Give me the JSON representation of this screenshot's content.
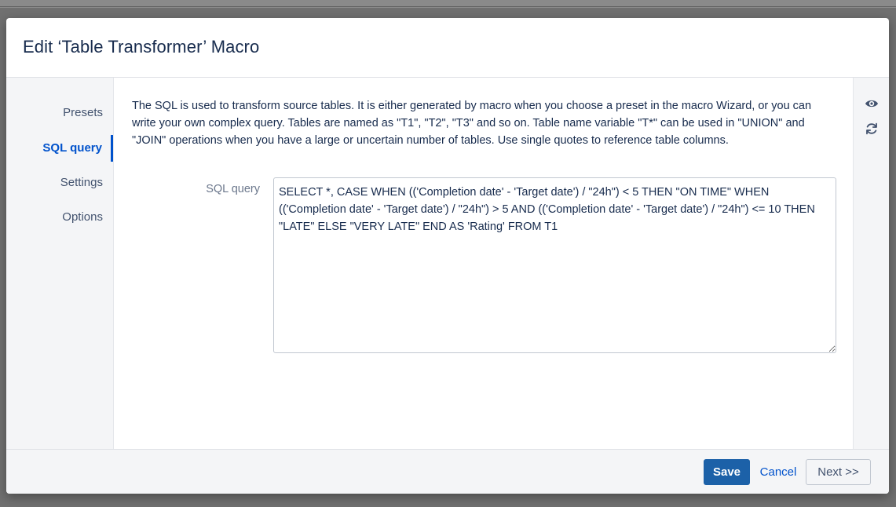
{
  "dialog": {
    "title": "Edit ‘Table Transformer’ Macro"
  },
  "nav": {
    "items": [
      {
        "label": "Presets",
        "active": false
      },
      {
        "label": "SQL query",
        "active": true
      },
      {
        "label": "Settings",
        "active": false
      },
      {
        "label": "Options",
        "active": false
      }
    ]
  },
  "main": {
    "description": "The SQL is used to transform source tables. It is either generated by macro when you choose a preset in the macro Wizard, or you can write your own complex query. Tables are named as \"T1\", \"T2\", \"T3\" and so on. Table name variable \"T*\" can be used in \"UNION\" and \"JOIN\" operations when you have a large or uncertain number of tables. Use single quotes to reference table columns.",
    "sql_label": "SQL query",
    "sql_value": "SELECT *, CASE WHEN (('Completion date' - 'Target date') / \"24h\") < 5 THEN \"ON TIME\" WHEN (('Completion date' - 'Target date') / \"24h\") > 5 AND (('Completion date' - 'Target date') / \"24h\") <= 10 THEN \"LATE\" ELSE \"VERY LATE\" END AS 'Rating' FROM T1"
  },
  "rail": {
    "icons": [
      "eye-icon",
      "refresh-icon"
    ]
  },
  "footer": {
    "save_label": "Save",
    "cancel_label": "Cancel",
    "next_label": "Next >>"
  },
  "colors": {
    "accent": "#0052cc",
    "primary_button": "#1c61a8",
    "panel_background": "#f4f5f7"
  }
}
